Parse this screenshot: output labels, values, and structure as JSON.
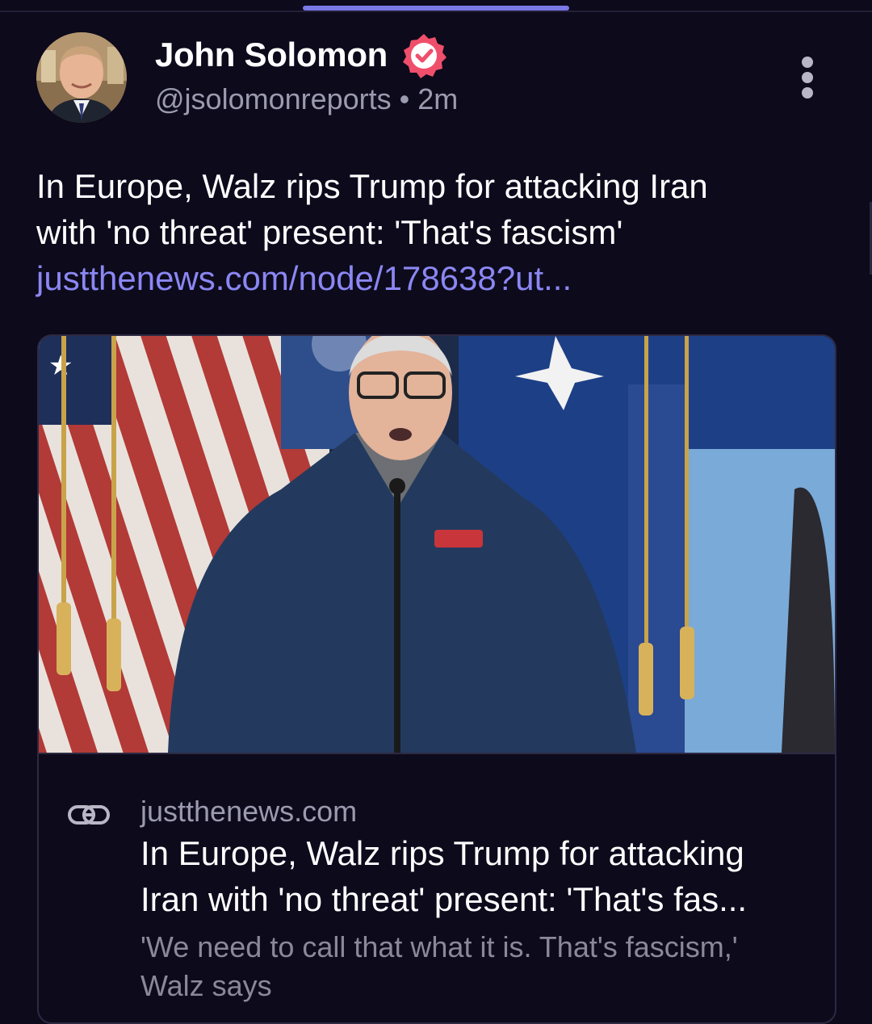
{
  "colors": {
    "background": "#0d0a1c",
    "link": "#8b87f3",
    "verified_badge": "#ef4f6b",
    "secondary_text": "#9c9aae"
  },
  "author": {
    "display_name": "John Solomon",
    "handle": "@jsolomonreports",
    "separator": "•",
    "time_ago": "2m",
    "verified": true,
    "badge_icon": "verified-check-badge"
  },
  "post": {
    "text_lines": [
      "In Europe, Walz rips Trump for attacking Iran",
      "with 'no threat' present: 'That's fascism'"
    ],
    "link": "justthenews.com/node/178638?ut..."
  },
  "link_card": {
    "image_icon": "news-photo",
    "domain_icon": "chain-link-icon",
    "domain": "justthenews.com",
    "title_lines": [
      "In Europe, Walz rips Trump for attacking",
      "Iran with 'no threat' present: 'That's fas..."
    ],
    "description_lines": [
      "'We need to call that what it is. That's fascism,'",
      "Walz says"
    ]
  }
}
